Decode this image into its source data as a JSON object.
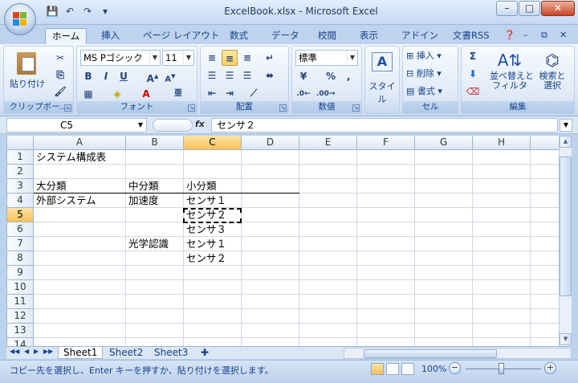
{
  "window": {
    "title": "ExcelBook.xlsx - Microsoft Excel",
    "controls": {
      "minimize": "–",
      "maximize": "□",
      "close": "✕"
    }
  },
  "qat": {
    "save_icon": "💾",
    "undo_icon": "↶",
    "redo_icon": "↷",
    "custom_icon": "▾"
  },
  "tabs": [
    {
      "label": "ホーム"
    },
    {
      "label": "挿入"
    },
    {
      "label": "ページ レイアウト"
    },
    {
      "label": "数式"
    },
    {
      "label": "データ"
    },
    {
      "label": "校閲"
    },
    {
      "label": "表示"
    },
    {
      "label": "アドイン"
    },
    {
      "label": "文書RSS"
    }
  ],
  "ribbon": {
    "clipboard": {
      "label": "クリップボー...",
      "paste": "貼り付け"
    },
    "font": {
      "label": "フォント",
      "name": "MS Pゴシック",
      "size": "11"
    },
    "alignment": {
      "label": "配置"
    },
    "number": {
      "label": "数値",
      "format": "標準"
    },
    "styles": {
      "label": "スタイル"
    },
    "cells": {
      "label": "セル",
      "insert": "挿入",
      "delete": "削除",
      "format": "書式"
    },
    "editing": {
      "label": "編集",
      "sort": "並べ替えと\nフィルタ",
      "find": "検索と\n選択"
    }
  },
  "formula_bar": {
    "name_box": "C5",
    "fx": "fx",
    "content": "センサ２"
  },
  "grid": {
    "columns": [
      "A",
      "B",
      "C",
      "D",
      "E",
      "F",
      "G",
      "H"
    ],
    "selected_column": "C",
    "rows": [
      "1",
      "2",
      "3",
      "4",
      "5",
      "6",
      "7",
      "8",
      "9",
      "10",
      "11",
      "12",
      "13",
      "14"
    ],
    "selected_row": "5",
    "cells": {
      "A1": "システム構成表",
      "A3": "大分類",
      "B3": "中分類",
      "C3": "小分類",
      "A4": "外部システム",
      "B4": "加速度",
      "C4": "センサ１",
      "C5": "センサ２",
      "C6": "センサ３",
      "B7": "光学認識",
      "C7": "センサ１",
      "C8": "センサ２"
    }
  },
  "sheets": [
    {
      "label": "Sheet1"
    },
    {
      "label": "Sheet2"
    },
    {
      "label": "Sheet3"
    }
  ],
  "status": {
    "message": "コピー先を選択し、Enter キーを押すか、貼り付けを選択します。",
    "zoom": "100%"
  }
}
